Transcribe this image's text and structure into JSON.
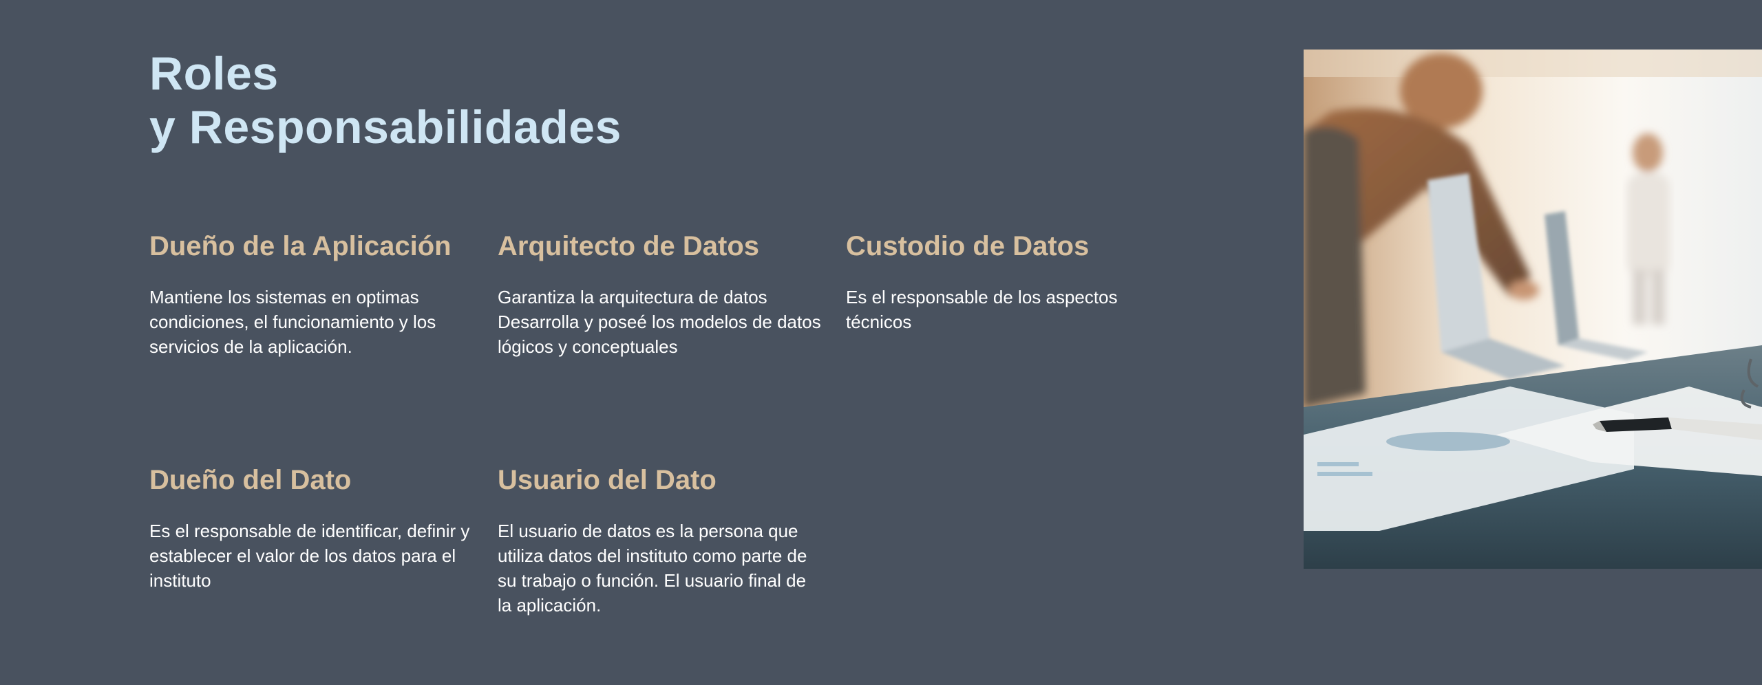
{
  "page": {
    "heading_line1": "Roles",
    "heading_line2": "y Responsabilidades"
  },
  "roles": [
    {
      "title": "Dueño de la Aplicación",
      "description": "Mantiene los sistemas en optimas condiciones, el funcionamiento y los servicios de la aplicación."
    },
    {
      "title": "Arquitecto de Datos",
      "description": "Garantiza la arquitectura de datos\nDesarrolla y poseé los modelos de datos lógicos y conceptuales"
    },
    {
      "title": "Custodio de Datos",
      "description": "Es el responsable de los aspectos técnicos"
    },
    {
      "title": "Dueño del Dato",
      "description": "Es el responsable de identificar, definir y establecer el valor de los datos para el instituto"
    },
    {
      "title": "Usuario del Dato",
      "description": "El usuario de datos es la persona que utiliza datos del instituto como parte de su trabajo o función. El usuario final de la aplicación."
    }
  ],
  "colors": {
    "background": "#49525f",
    "heading": "#cfe6f4",
    "role_title": "#d8c09f",
    "body_text": "#ffffff"
  }
}
